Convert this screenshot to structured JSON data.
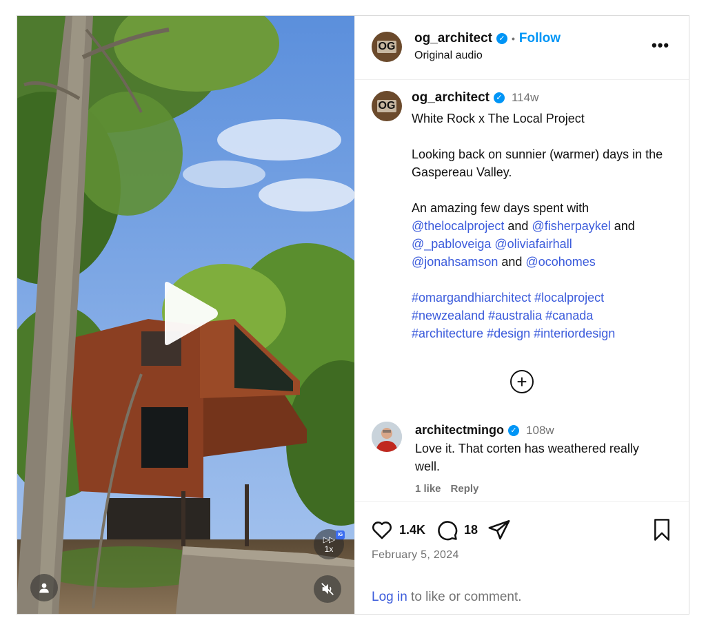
{
  "post": {
    "author": "og_architect",
    "avatar_text": "OG",
    "follow_label": "Follow",
    "dot": "•",
    "audio": "Original audio",
    "more_label": "•••"
  },
  "caption": {
    "author": "og_architect",
    "time": "114w",
    "line1": "White Rock x The Local Project",
    "line2": "Looking back on sunnier (warmer) days in the Gaspereau Valley.",
    "line3_prefix": "An amazing few days spent with",
    "mentions": [
      "@thelocalproject",
      "@fisherpaykel",
      "@_pabloveiga",
      "@oliviafairhall",
      "@jonahsamson",
      "@ocohomes"
    ],
    "and": "and",
    "hashtags": [
      "#omargandhiarchitect",
      "#localproject",
      "#newzealand",
      "#australia",
      "#canada",
      "#architecture",
      "#design",
      "#interiordesign"
    ]
  },
  "load_more_label": "+",
  "comment": {
    "author": "architectmingo",
    "time": "108w",
    "text": "Love it. That corten has weathered really well.",
    "likes": "1 like",
    "reply": "Reply"
  },
  "actions": {
    "likes": "1.4K",
    "comments": "18",
    "date": "February 5, 2024",
    "login_link": "Log in",
    "login_suffix": " to like or comment."
  },
  "video": {
    "speed": "1x",
    "speed_glyph": "▷▷",
    "badge": "IG"
  },
  "colors": {
    "link": "#3b5bdb",
    "verified": "#0095f6",
    "corten": "#8b3f22",
    "sky": "#6fa4e6"
  },
  "icons": [
    "play-icon",
    "fast-forward-icon",
    "mute-icon",
    "user-tag-icon",
    "verified-icon",
    "more-icon",
    "plus-circle-icon",
    "heart-icon",
    "comment-icon",
    "share-icon",
    "bookmark-icon"
  ]
}
